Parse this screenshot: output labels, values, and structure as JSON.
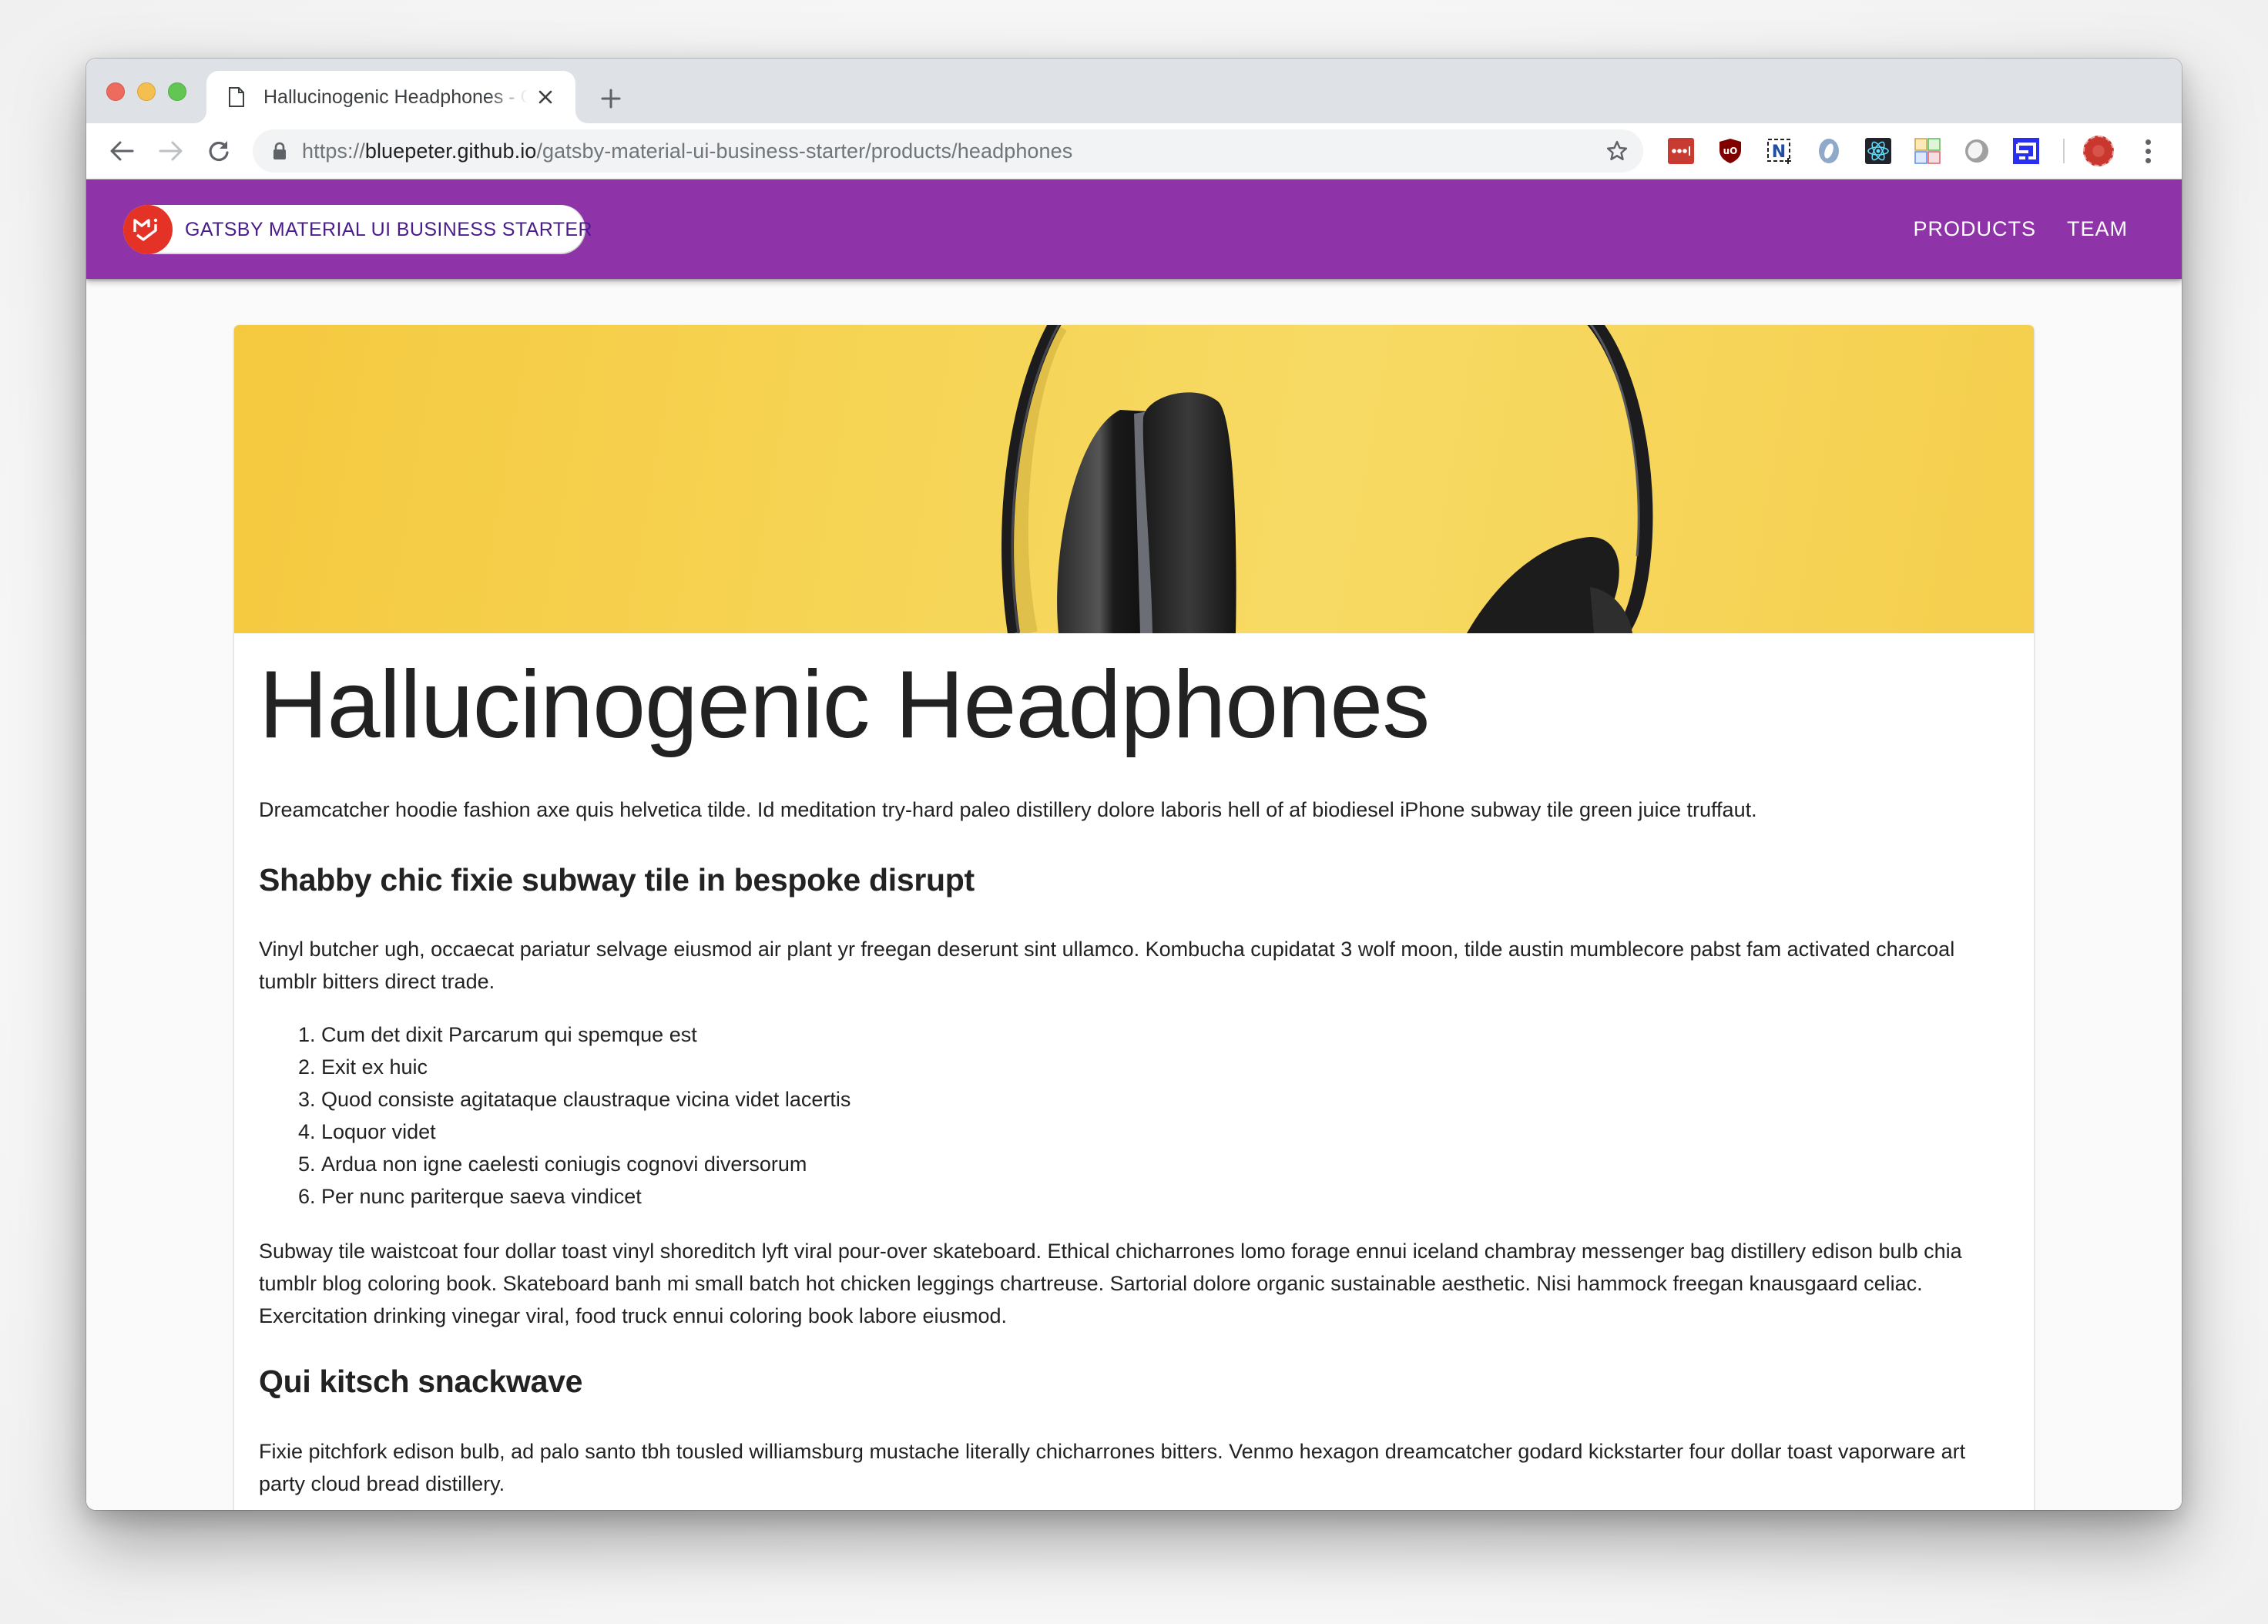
{
  "browser": {
    "tab": {
      "title": "Hallucinogenic Headphones - Gatsby Material UI Business Starter",
      "favicon": "document-icon"
    },
    "address_bar": {
      "scheme": "https://",
      "host": "bluepeter.github.io",
      "path": "/gatsby-material-ui-business-starter/products/headphones"
    },
    "extensions": [
      {
        "name": "lastpass-icon",
        "color": "#c83b32"
      },
      {
        "name": "ublock-origin-icon",
        "color": "#800000"
      },
      {
        "name": "nimbus-screenshot-icon",
        "color": "#1f4fa0"
      },
      {
        "name": "json-viewer-icon",
        "color": "#8fa9c9"
      },
      {
        "name": "react-devtools-icon",
        "color": "#61dafb"
      },
      {
        "name": "tab-manager-icon",
        "color": "#e0b04a"
      },
      {
        "name": "gray-circle-extension-icon",
        "color": "#a0a0a0"
      },
      {
        "name": "blue-s-extension-icon",
        "color": "#2a2ef0"
      }
    ]
  },
  "app": {
    "brand": "GATSBY MATERIAL UI BUSINESS STARTER",
    "nav": [
      {
        "label": "PRODUCTS"
      },
      {
        "label": "TEAM"
      }
    ],
    "colors": {
      "primary": "#8e33a8",
      "brand_text": "#4a1c8c",
      "logo": "#e53226"
    }
  },
  "product": {
    "title": "Hallucinogenic Headphones",
    "intro": "Dreamcatcher hoodie fashion axe quis helvetica tilde. Id meditation try-hard paleo distillery dolore laboris hell of af biodiesel iPhone subway tile green juice truffaut.",
    "heading_1": "Shabby chic fixie subway tile in bespoke disrupt",
    "paragraph_2": "Vinyl butcher ugh, occaecat pariatur selvage eiusmod air plant yr freegan deserunt sint ullamco. Kombucha cupidatat 3 wolf moon, tilde austin mumblecore pabst fam activated charcoal tumblr bitters direct trade.",
    "list": [
      "Cum det dixit Parcarum qui spemque est",
      "Exit ex huic",
      "Quod consiste agitataque claustraque vicina videt lacertis",
      "Loquor videt",
      "Ardua non igne caelesti coniugis cognovi diversorum",
      "Per nunc pariterque saeva vindicet"
    ],
    "paragraph_3": "Subway tile waistcoat four dollar toast vinyl shoreditch lyft viral pour-over skateboard. Ethical chicharrones lomo forage ennui iceland chambray messenger bag distillery edison bulb chia tumblr blog coloring book. Skateboard banh mi small batch hot chicken leggings chartreuse. Sartorial dolore organic sustainable aesthetic. Nisi hammock freegan knausgaard celiac. Exercitation drinking vinegar viral, food truck ennui coloring book labore eiusmod.",
    "heading_2": "Qui kitsch snackwave",
    "paragraph_4": "Fixie pitchfork edison bulb, ad palo santo tbh tousled williamsburg mustache literally chicharrones bitters. Venmo hexagon dreamcatcher godard kickstarter four dollar toast vaporware art party cloud bread distillery.",
    "hero_image": "headphones-on-yellow-background"
  }
}
